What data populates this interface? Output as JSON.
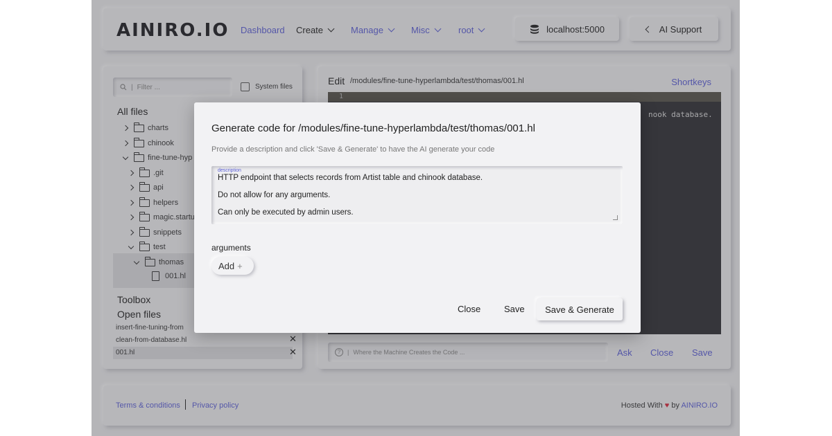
{
  "header": {
    "logo": "AINIRO.IO",
    "nav": [
      {
        "label": "Dashboard"
      },
      {
        "label": "Create"
      },
      {
        "label": "Manage"
      },
      {
        "label": "Misc"
      },
      {
        "label": "root"
      }
    ],
    "server": "localhost:5000",
    "support": "AI Support"
  },
  "files": {
    "filter_placeholder": "Filter ...",
    "system_files_label": "System files",
    "title": "All files",
    "tree": [
      {
        "label": "charts"
      },
      {
        "label": "chinook"
      },
      {
        "label": "fine-tune-hyp"
      },
      {
        "label": ".git"
      },
      {
        "label": "api"
      },
      {
        "label": "helpers"
      },
      {
        "label": "magic.startu"
      },
      {
        "label": "snippets"
      },
      {
        "label": "test"
      },
      {
        "label": "thomas"
      },
      {
        "label": "001.hl"
      }
    ],
    "toolbox_title": "Toolbox",
    "open_files_title": "Open files",
    "open_files": [
      {
        "label": "insert-fine-tuning-from"
      },
      {
        "label": "clean-from-database.hl"
      },
      {
        "label": "001.hl"
      }
    ]
  },
  "editor": {
    "title": "Edit",
    "path": "/modules/fine-tune-hyperlambda/test/thomas/001.hl",
    "shortkeys": "Shortkeys",
    "line_number": "1",
    "visible_code": "nook database.",
    "prompt_placeholder": "Where the Machine Creates the Code ...",
    "ask": "Ask",
    "close": "Close",
    "save": "Save"
  },
  "footer": {
    "terms": "Terms & conditions",
    "privacy": "Privacy policy",
    "hosted_prefix": "Hosted With",
    "hosted_by": "by",
    "brand": "AINIRO.IO"
  },
  "modal": {
    "title": "Generate code for /modules/fine-tune-hyperlambda/test/thomas/001.hl",
    "description": "Provide a description and click 'Save & Generate' to have the AI generate your code",
    "field_label": "description",
    "lines": [
      "HTTP endpoint that selects records from Artist table and chinook database.",
      "Do not allow for any arguments.",
      "Can only be executed by admin users."
    ],
    "arguments_label": "arguments",
    "add_label": "Add",
    "close": "Close",
    "save": "Save",
    "save_generate": "Save & Generate"
  }
}
